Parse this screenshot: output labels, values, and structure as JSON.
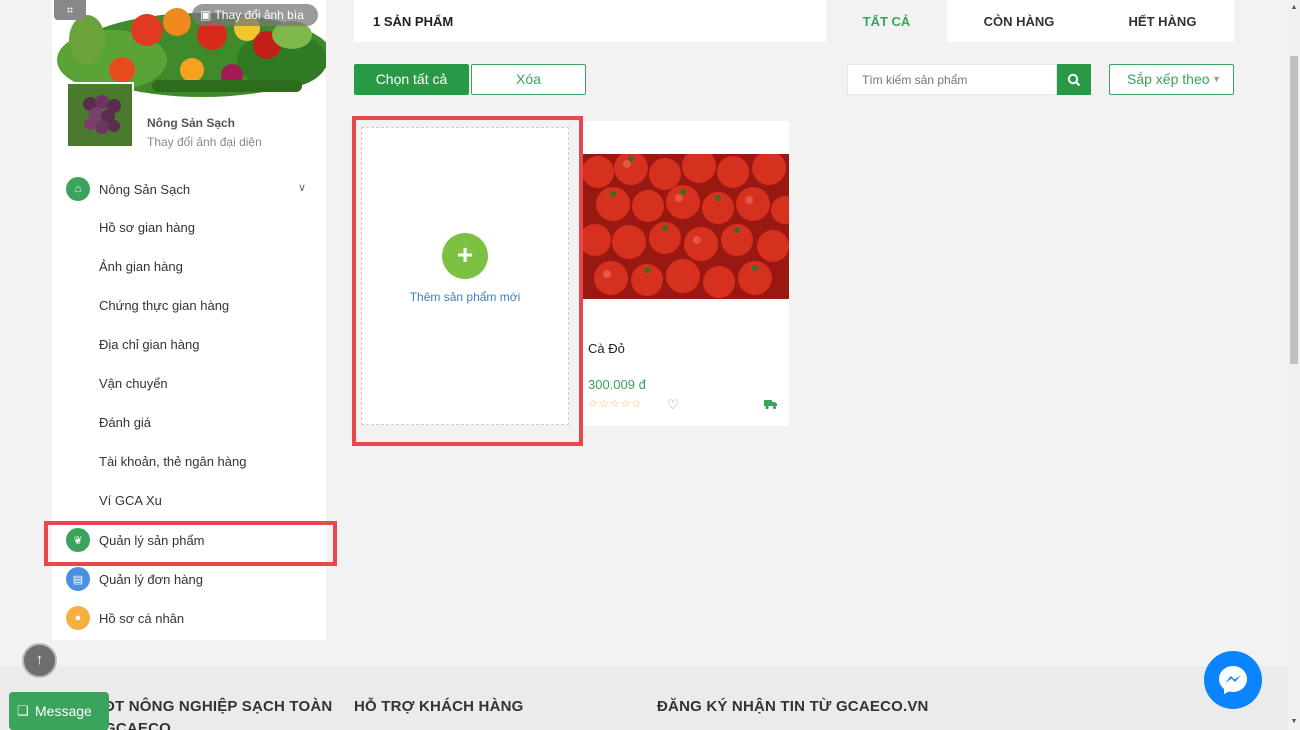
{
  "sidebar": {
    "cover_change_label": "Thay đổi ảnh bìa",
    "shop_name": "Nông Sản Sạch",
    "avatar_change_label": "Thay đổi ảnh đại diện",
    "group_label": "Nông Sản Sạch",
    "sub_items": [
      "Hồ sơ gian hàng",
      "Ảnh gian hàng",
      "Chứng thực gian hàng",
      "Địa chỉ gian hàng",
      "Vận chuyển",
      "Đánh giá",
      "Tài khoản, thẻ ngân hàng",
      "Ví GCA Xu"
    ],
    "main_items": [
      "Quản lý sản phẩm",
      "Quản lý đơn hàng",
      "Hồ sơ cá nhân"
    ]
  },
  "topbar": {
    "count_label": "1 SẢN PHẨM",
    "tabs": [
      "TẤT CẢ",
      "CÒN HÀNG",
      "HẾT HÀNG"
    ],
    "active_tab": "TẤT CẢ"
  },
  "actions": {
    "select_all_label": "Chọn tất cả",
    "delete_label": "Xóa",
    "search_placeholder": "Tìm kiếm sản phẩm",
    "sort_label": "Sắp xếp theo"
  },
  "add_card": {
    "label": "Thêm sản phẩm mới"
  },
  "product": {
    "name": "Cà Đỏ",
    "price": "300.009 đ",
    "stars": "☆☆☆☆☆",
    "rating": 0
  },
  "footer": {
    "col1": "ĐT NÔNG NGHIỆP SẠCH TOÀN",
    "col1_line2": "GCAECO",
    "col2": "HỖ TRỢ KHÁCH HÀNG",
    "col3": "ĐĂNG KÝ NHẬN TIN TỪ GCAECO.VN"
  },
  "widgets": {
    "message_label": "Message"
  },
  "colors": {
    "accent": "#289a45",
    "highlight": "#e8474c",
    "link": "#3d7fc4"
  }
}
